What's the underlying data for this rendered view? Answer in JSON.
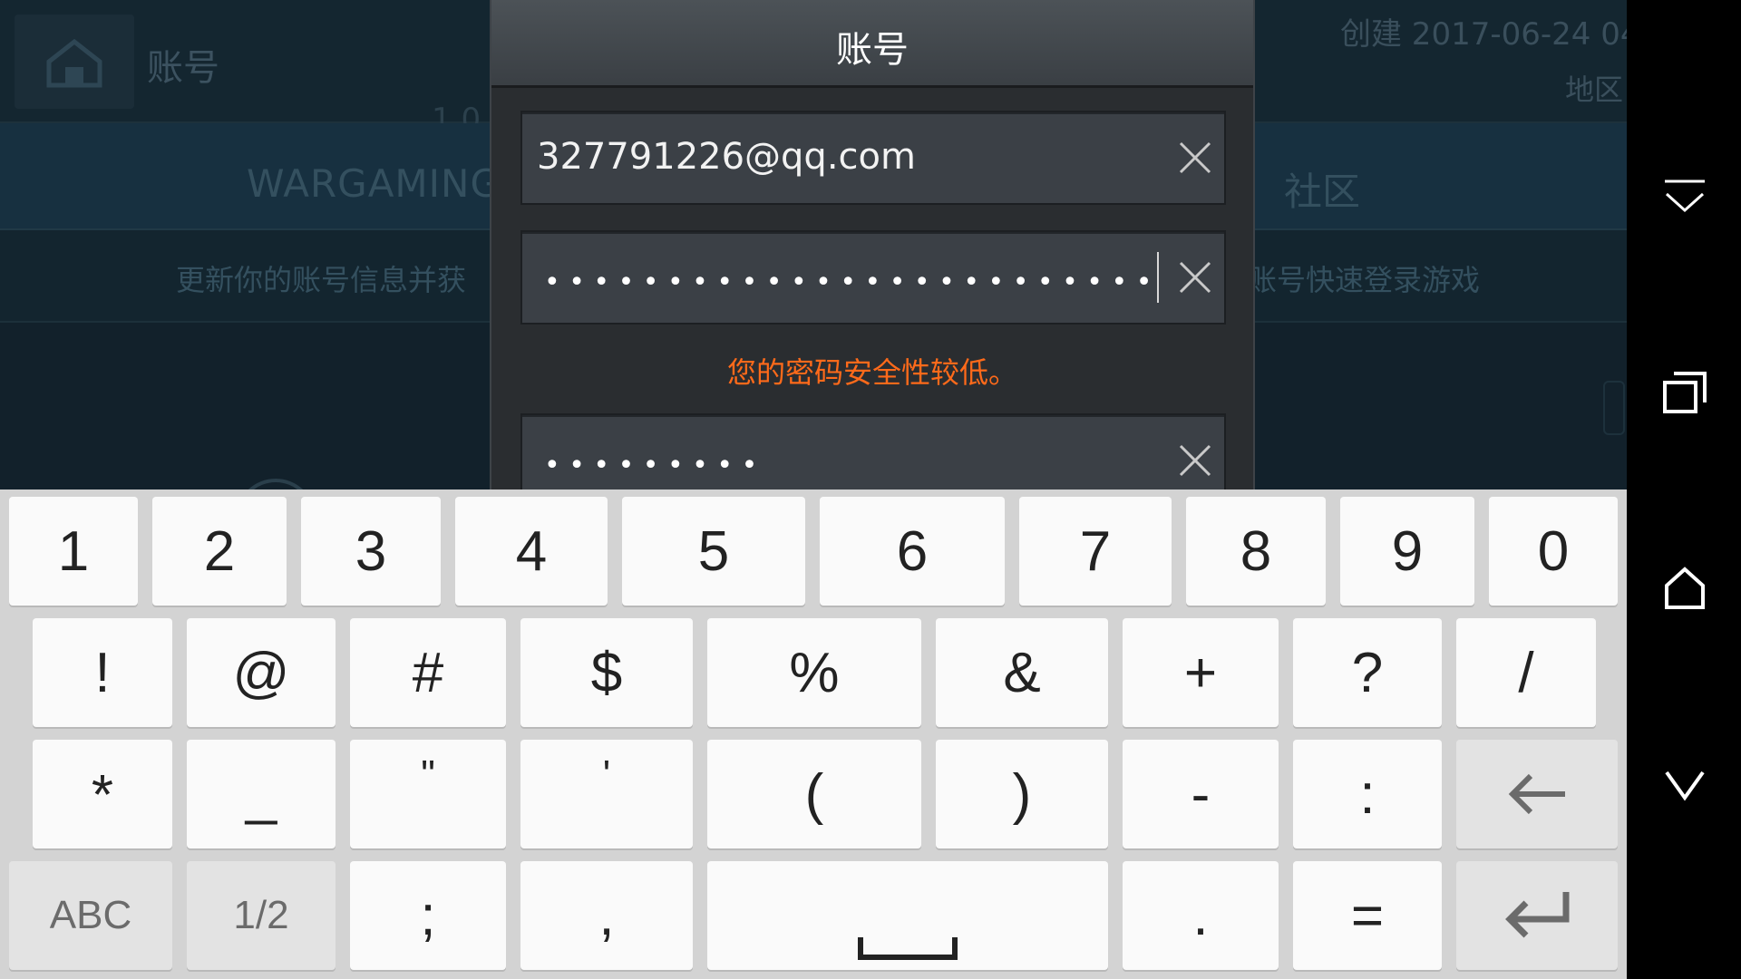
{
  "background": {
    "header_title": "账号",
    "created_text": "创建 2017-06-24 04",
    "region_text": "地区",
    "digits_fragment": "1 0",
    "tab_wargaming": "WARGAMING.",
    "tab_community": "社区",
    "banner_left": "更新你的账号信息并获",
    "banner_right": "账号快速登录游戏"
  },
  "dialog": {
    "title": "账号",
    "email_value": "327791226@qq.com",
    "password_mask": "•••••••••••••••••••••••••",
    "password_warning": "您的密码安全性较低。",
    "confirm_mask": "•••••••••"
  },
  "keyboard": {
    "row1": [
      "1",
      "2",
      "3",
      "4",
      "5",
      "6",
      "7",
      "8",
      "9",
      "0"
    ],
    "row2": [
      "!",
      "@",
      "#",
      "$",
      "%",
      "&",
      "+",
      "?",
      "/"
    ],
    "row3": [
      "*",
      "_",
      "\"",
      "'",
      "(",
      ")",
      "-",
      ":"
    ],
    "row4": {
      "abc_label": "ABC",
      "page_label": "1/2",
      "semicolon": ";",
      "comma": ",",
      "period": ".",
      "equals": "="
    }
  },
  "colors": {
    "warning": "#ff6a1a",
    "dialog_bg": "#2a2d30",
    "keyboard_bg": "#d3d3d3"
  },
  "icons": {
    "home": "home-icon",
    "clear": "close-icon",
    "backspace": "backspace-arrow-icon",
    "enter": "enter-icon",
    "space": "space-icon",
    "nav_collapse": "chevron-down-collapse-icon",
    "nav_recents": "recents-icon",
    "nav_home": "home-outline-icon",
    "nav_back": "chevron-down-icon"
  }
}
